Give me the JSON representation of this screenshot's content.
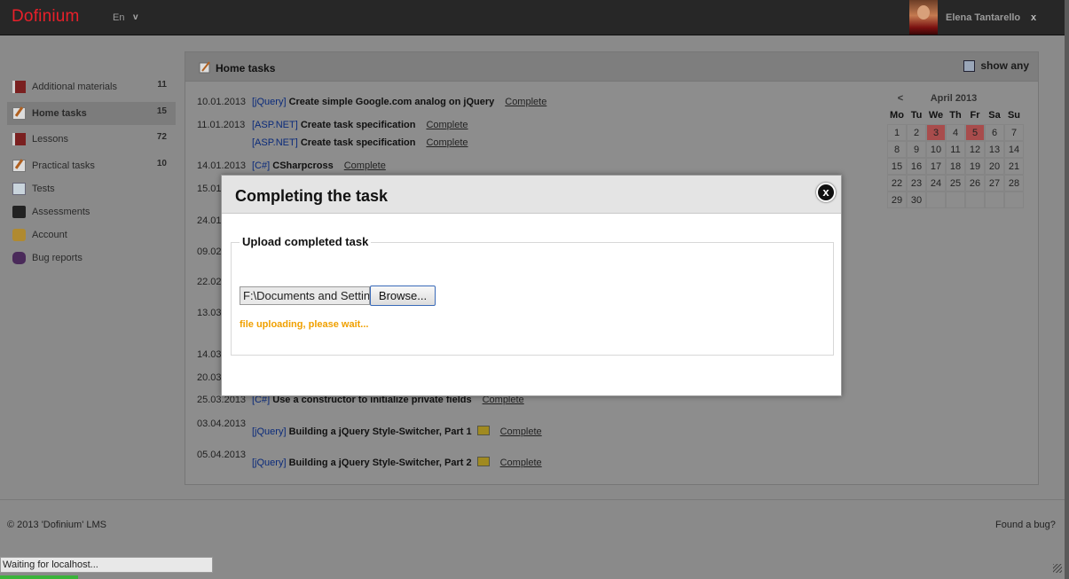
{
  "header": {
    "logo": "Dofinium",
    "language": "En",
    "language_caret": "v",
    "username": "Elena Tantarello",
    "logout": "x"
  },
  "sidebar": {
    "items": [
      {
        "label": "Additional materials",
        "count": "11",
        "icon": "book-icon"
      },
      {
        "label": "Home tasks",
        "count": "15",
        "icon": "notepad-icon",
        "active": true
      },
      {
        "label": "Lessons",
        "count": "72",
        "icon": "book-icon"
      },
      {
        "label": "Practical tasks",
        "count": "10",
        "icon": "notepad-icon"
      },
      {
        "label": "Tests",
        "count": "",
        "icon": "test-icon"
      },
      {
        "label": "Assessments",
        "count": "",
        "icon": "assessment-icon"
      },
      {
        "label": "Account",
        "count": "",
        "icon": "account-icon"
      },
      {
        "label": "Bug reports",
        "count": "",
        "icon": "bug-icon"
      }
    ]
  },
  "main": {
    "title": "Home tasks",
    "show_any": "show any",
    "tasks": [
      {
        "date": "10.01.2013",
        "lines": [
          {
            "tag": "[jQuery]",
            "name": "Create simple Google.com analog on jQuery",
            "action": "Complete"
          }
        ]
      },
      {
        "date": "11.01.2013",
        "lines": [
          {
            "tag": "[ASP.NET]",
            "name": "Create task specification",
            "action": "Complete"
          },
          {
            "tag": "[ASP.NET]",
            "name": "Create task specification",
            "action": "Complete"
          }
        ]
      },
      {
        "date": "14.01.2013",
        "lines": [
          {
            "tag": "[C#]",
            "name": "CSharpcross",
            "action": "Complete"
          }
        ]
      },
      {
        "date": "15.01",
        "lines": []
      },
      {
        "date": "24.01",
        "lines": []
      },
      {
        "date": "09.02",
        "lines": []
      },
      {
        "date": "22.02",
        "lines": []
      },
      {
        "date": "13.03",
        "lines": []
      },
      {
        "date": "14.03",
        "lines": []
      },
      {
        "date": "20.03",
        "lines": []
      },
      {
        "date": "25.03.2013",
        "lines": [
          {
            "tag": "[C#]",
            "name": "Use a constructor to initialize private fields",
            "action": "Complete"
          }
        ]
      },
      {
        "date": "03.04.2013",
        "lines": [
          {
            "tag": "[jQuery]",
            "name": "Building a jQuery Style-Switcher, Part 1",
            "action": "Complete",
            "attachment": true
          }
        ]
      },
      {
        "date": "05.04.2013",
        "lines": [
          {
            "tag": "[jQuery]",
            "name": "Building a jQuery Style-Switcher, Part 2",
            "action": "Complete",
            "attachment": true
          }
        ]
      }
    ]
  },
  "calendar": {
    "prev": "<",
    "title": "April 2013",
    "weekdays": [
      "Mo",
      "Tu",
      "We",
      "Th",
      "Fr",
      "Sa",
      "Su"
    ],
    "days": [
      "1",
      "2",
      "3",
      "4",
      "5",
      "6",
      "7",
      "8",
      "9",
      "10",
      "11",
      "12",
      "13",
      "14",
      "15",
      "16",
      "17",
      "18",
      "19",
      "20",
      "21",
      "22",
      "23",
      "24",
      "25",
      "26",
      "27",
      "28",
      "29",
      "30"
    ],
    "marked_days": [
      "3",
      "5"
    ],
    "marked_color": "#a84c4c"
  },
  "footer": {
    "copyright": "© 2013 'Dofinium' LMS",
    "found_bug": "Found a bug?"
  },
  "status_bar": {
    "text": "Waiting for localhost..."
  },
  "modal": {
    "title": "Completing the task",
    "close_label": "x",
    "legend": "Upload completed task",
    "file_value": "F:\\Documents and Settin",
    "browse_label": "Browse...",
    "message": "file uploading, please wait..."
  },
  "colors": {
    "logo": "#e8202a",
    "upload_message": "#f0a000",
    "tag": "#0a2a7a"
  }
}
